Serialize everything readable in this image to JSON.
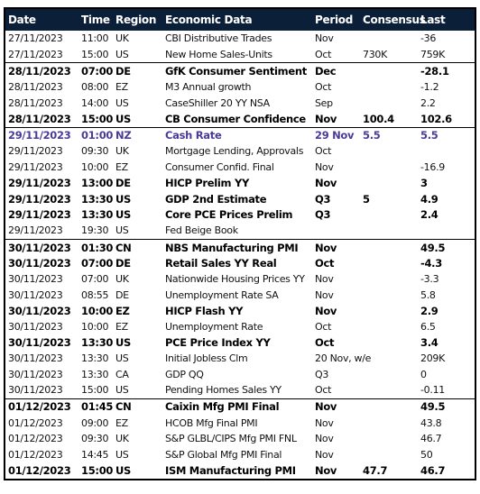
{
  "headers": {
    "date": "Date",
    "time": "Time",
    "region": "Region",
    "data": "Economic Data",
    "period": "Period",
    "consensus": "Consensus",
    "last": "Last"
  },
  "colors": {
    "header_bg": "#0c1f38",
    "highlight_text": "#4b3a96"
  },
  "rows": [
    {
      "date": "27/11/2023",
      "time": "11:00",
      "region": "UK",
      "data": "CBI Distributive Trades",
      "period": "Nov",
      "consensus": "",
      "last": "-36",
      "style": "normal",
      "group_start": false
    },
    {
      "date": "27/11/2023",
      "time": "15:00",
      "region": "US",
      "data": "New Home Sales-Units",
      "period": "Oct",
      "consensus": "730K",
      "last": "759K",
      "style": "normal",
      "group_start": false
    },
    {
      "date": "28/11/2023",
      "time": "07:00",
      "region": "DE",
      "data": "GfK Consumer Sentiment",
      "period": "Dec",
      "consensus": "",
      "last": "-28.1",
      "style": "bold",
      "group_start": true
    },
    {
      "date": "28/11/2023",
      "time": "08:00",
      "region": "EZ",
      "data": "M3 Annual growth",
      "period": "Oct",
      "consensus": "",
      "last": "-1.2",
      "style": "normal",
      "group_start": false
    },
    {
      "date": "28/11/2023",
      "time": "14:00",
      "region": "US",
      "data": "CaseShiller 20 YY NSA",
      "period": "Sep",
      "consensus": "",
      "last": "2.2",
      "style": "normal",
      "group_start": false
    },
    {
      "date": "28/11/2023",
      "time": "15:00",
      "region": "US",
      "data": "CB Consumer Confidence",
      "period": "Nov",
      "consensus": "100.4",
      "last": "102.6",
      "style": "bold",
      "group_start": false
    },
    {
      "date": "29/11/2023",
      "time": "01:00",
      "region": "NZ",
      "data": "Cash Rate",
      "period": "29 Nov",
      "consensus": "5.5",
      "last": "5.5",
      "style": "highlight",
      "group_start": true
    },
    {
      "date": "29/11/2023",
      "time": "09:30",
      "region": "UK",
      "data": "Mortgage Lending, Approvals",
      "period": "Oct",
      "consensus": "",
      "last": "",
      "style": "normal",
      "group_start": false
    },
    {
      "date": "29/11/2023",
      "time": "10:00",
      "region": "EZ",
      "data": "Consumer Confid. Final",
      "period": "Nov",
      "consensus": "",
      "last": "-16.9",
      "style": "normal",
      "group_start": false
    },
    {
      "date": "29/11/2023",
      "time": "13:00",
      "region": "DE",
      "data": "HICP Prelim YY",
      "period": "Nov",
      "consensus": "",
      "last": "3",
      "style": "bold",
      "group_start": false
    },
    {
      "date": "29/11/2023",
      "time": "13:30",
      "region": "US",
      "data": "GDP 2nd Estimate",
      "period": "Q3",
      "consensus": "5",
      "last": "4.9",
      "style": "bold",
      "group_start": false
    },
    {
      "date": "29/11/2023",
      "time": "13:30",
      "region": "US",
      "data": "Core PCE Prices Prelim",
      "period": "Q3",
      "consensus": "",
      "last": "2.4",
      "style": "bold",
      "group_start": false
    },
    {
      "date": "29/11/2023",
      "time": "19:30",
      "region": "US",
      "data": "Fed Beige Book",
      "period": "",
      "consensus": "",
      "last": "",
      "style": "normal",
      "group_start": false
    },
    {
      "date": "30/11/2023",
      "time": "01:30",
      "region": "CN",
      "data": "NBS Manufacturing PMI",
      "period": "Nov",
      "consensus": "",
      "last": "49.5",
      "style": "bold",
      "group_start": true
    },
    {
      "date": "30/11/2023",
      "time": "07:00",
      "region": "DE",
      "data": "Retail Sales YY Real",
      "period": "Oct",
      "consensus": "",
      "last": "-4.3",
      "style": "bold",
      "group_start": false
    },
    {
      "date": "30/11/2023",
      "time": "07:00",
      "region": "UK",
      "data": "Nationwide Housing Prices YY",
      "period": "Nov",
      "consensus": "",
      "last": "-3.3",
      "style": "normal",
      "group_start": false
    },
    {
      "date": "30/11/2023",
      "time": "08:55",
      "region": "DE",
      "data": "Unemployment Rate SA",
      "period": "Nov",
      "consensus": "",
      "last": "5.8",
      "style": "normal",
      "group_start": false
    },
    {
      "date": "30/11/2023",
      "time": "10:00",
      "region": "EZ",
      "data": "HICP Flash YY",
      "period": "Nov",
      "consensus": "",
      "last": "2.9",
      "style": "bold",
      "group_start": false
    },
    {
      "date": "30/11/2023",
      "time": "10:00",
      "region": "EZ",
      "data": "Unemployment Rate",
      "period": "Oct",
      "consensus": "",
      "last": "6.5",
      "style": "normal",
      "group_start": false
    },
    {
      "date": "30/11/2023",
      "time": "13:30",
      "region": "US",
      "data": "PCE Price Index YY",
      "period": "Oct",
      "consensus": "",
      "last": "3.4",
      "style": "bold",
      "group_start": false
    },
    {
      "date": "30/11/2023",
      "time": "13:30",
      "region": "US",
      "data": "Initial Jobless Clm",
      "period": "20 Nov, w/e",
      "consensus": "",
      "last": "209K",
      "style": "normal",
      "group_start": false
    },
    {
      "date": "30/11/2023",
      "time": "13:30",
      "region": "CA",
      "data": "GDP QQ",
      "period": "Q3",
      "consensus": "",
      "last": "0",
      "style": "normal",
      "group_start": false
    },
    {
      "date": "30/11/2023",
      "time": "15:00",
      "region": "US",
      "data": "Pending Homes Sales YY",
      "period": "Oct",
      "consensus": "",
      "last": "-0.11",
      "style": "normal",
      "group_start": false
    },
    {
      "date": "01/12/2023",
      "time": "01:45",
      "region": "CN",
      "data": "Caixin Mfg PMI Final",
      "period": "Nov",
      "consensus": "",
      "last": "49.5",
      "style": "bold",
      "group_start": true
    },
    {
      "date": "01/12/2023",
      "time": "09:00",
      "region": "EZ",
      "data": "HCOB Mfg Final PMI",
      "period": "Nov",
      "consensus": "",
      "last": "43.8",
      "style": "normal",
      "group_start": false
    },
    {
      "date": "01/12/2023",
      "time": "09:30",
      "region": "UK",
      "data": "S&P GLBL/CIPS Mfg PMI FNL",
      "period": "Nov",
      "consensus": "",
      "last": "46.7",
      "style": "normal",
      "group_start": false
    },
    {
      "date": "01/12/2023",
      "time": "14:45",
      "region": "US",
      "data": "S&P Global Mfg PMI Final",
      "period": "Nov",
      "consensus": "",
      "last": "50",
      "style": "normal",
      "group_start": false
    },
    {
      "date": "01/12/2023",
      "time": "15:00",
      "region": "US",
      "data": "ISM Manufacturing PMI",
      "period": "Nov",
      "consensus": "47.7",
      "last": "46.7",
      "style": "bold",
      "group_start": false
    }
  ]
}
